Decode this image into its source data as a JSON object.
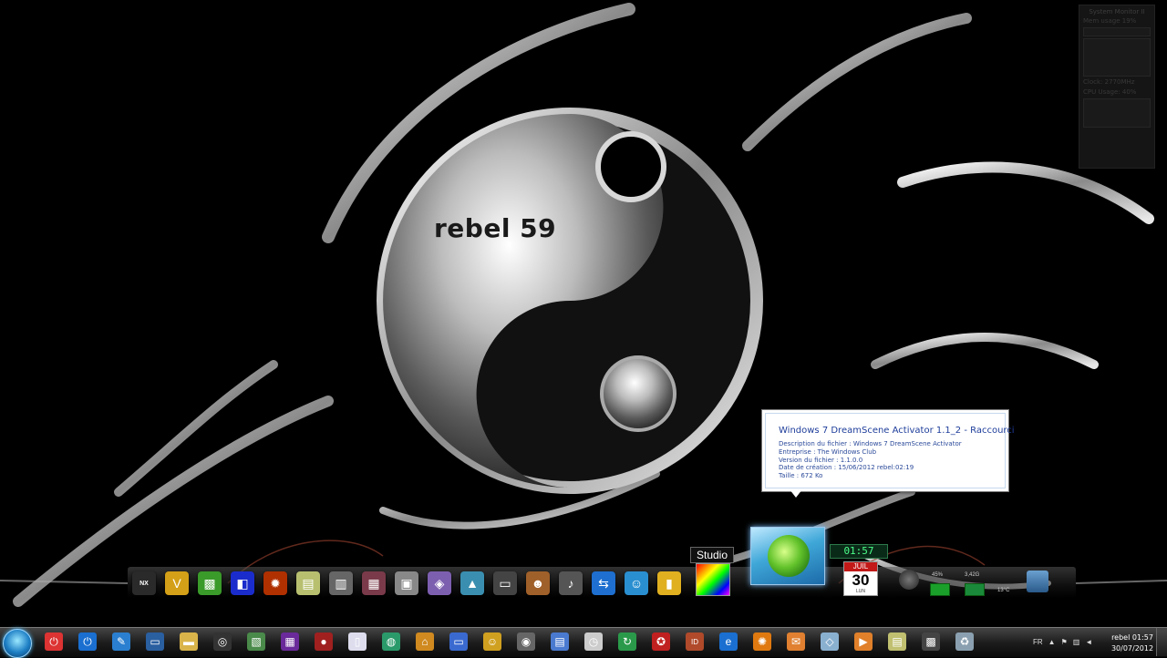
{
  "desktop": {
    "label": "rebel 59"
  },
  "system_monitor": {
    "title": "System Monitor II",
    "memory_label": "Mem usage",
    "memory_value": "19%",
    "clock_label": "Clock:",
    "clock_value": "2770MHz",
    "cpu_label": "CPU Usage:",
    "cpu_value": "40%"
  },
  "tooltip": {
    "title": "Windows 7 DreamScene Activator 1.1_2 - Raccourci",
    "lines": [
      "Description du fichier : Windows 7 DreamScene Activator",
      "Entreprise : The Windows Club",
      "Version du fichier : 1.1.0.0",
      "Date de création : 15/06/2012 rebel:02:19",
      "Taille : 672 Ko"
    ]
  },
  "dock": {
    "icons": [
      {
        "name": "nexus-icon",
        "glyph": "NX",
        "color": "#2a2a2a"
      },
      {
        "name": "v-icon",
        "glyph": "V",
        "color": "#d4a017"
      },
      {
        "name": "green-app-icon",
        "glyph": "▩",
        "color": "#3a9a2a"
      },
      {
        "name": "blue-square-icon",
        "glyph": "◧",
        "color": "#1b2ccc"
      },
      {
        "name": "fire-icon",
        "glyph": "✹",
        "color": "#b03000"
      },
      {
        "name": "notes-icon",
        "glyph": "▤",
        "color": "#b8c070"
      },
      {
        "name": "book-icon",
        "glyph": "▥",
        "color": "#666"
      },
      {
        "name": "book2-icon",
        "glyph": "▦",
        "color": "#7a3a4a"
      },
      {
        "name": "speaker-icon",
        "glyph": "▣",
        "color": "#888"
      },
      {
        "name": "palette-icon",
        "glyph": "◈",
        "color": "#7d5fb0"
      },
      {
        "name": "triangle-icon",
        "glyph": "▲",
        "color": "#3a8fb0"
      },
      {
        "name": "monitor-icon",
        "glyph": "▭",
        "color": "#444"
      },
      {
        "name": "mascot-icon",
        "glyph": "☻",
        "color": "#a0602a"
      },
      {
        "name": "microphone-icon",
        "glyph": "♪",
        "color": "#555"
      },
      {
        "name": "teamviewer-icon",
        "glyph": "⇆",
        "color": "#1e6fd0"
      },
      {
        "name": "user-icon",
        "glyph": "☺",
        "color": "#2a8fd0"
      },
      {
        "name": "folder-yellow-icon",
        "glyph": "▮",
        "color": "#e0b020"
      }
    ],
    "studio_label": "Studio"
  },
  "gadgets": {
    "digital_clock": "01:57",
    "calendar_month": "JUIL",
    "calendar_day": "30",
    "calendar_dow": "LUN",
    "battery_percent": "45%",
    "network_value": "3,42G",
    "temperature": "13°C"
  },
  "taskbar": {
    "icons": [
      {
        "name": "shutdown-icon",
        "glyph": "⏻",
        "color": "#d33"
      },
      {
        "name": "power-icon",
        "glyph": "⏻",
        "color": "#1a6fd0"
      },
      {
        "name": "tools-icon",
        "glyph": "✎",
        "color": "#2a7fd0"
      },
      {
        "name": "computer-icon",
        "glyph": "▭",
        "color": "#2a5fa0"
      },
      {
        "name": "folder-icon",
        "glyph": "▬",
        "color": "#d9b44a"
      },
      {
        "name": "disc-icon",
        "glyph": "◎",
        "color": "#333"
      },
      {
        "name": "image-icon",
        "glyph": "▧",
        "color": "#4a8a4a"
      },
      {
        "name": "cpuz-icon",
        "glyph": "▦",
        "color": "#6a2a9a"
      },
      {
        "name": "ball-icon",
        "glyph": "●",
        "color": "#a02020"
      },
      {
        "name": "document-icon",
        "glyph": "▯",
        "color": "#dde"
      },
      {
        "name": "globe-icon",
        "glyph": "◍",
        "color": "#2a9a6a"
      },
      {
        "name": "home-icon",
        "glyph": "⌂",
        "color": "#d08a20"
      },
      {
        "name": "monitor-small-icon",
        "glyph": "▭",
        "color": "#3a6ad0"
      },
      {
        "name": "smiley-icon",
        "glyph": "☺",
        "color": "#d0a020"
      },
      {
        "name": "camera-icon",
        "glyph": "◉",
        "color": "#666"
      },
      {
        "name": "network-icon",
        "glyph": "▤",
        "color": "#4a7ad0"
      },
      {
        "name": "clock-icon",
        "glyph": "◷",
        "color": "#ccc"
      },
      {
        "name": "refresh-icon",
        "glyph": "↻",
        "color": "#2a9a4a"
      },
      {
        "name": "ccleaner-icon",
        "glyph": "✪",
        "color": "#c02020"
      },
      {
        "name": "id-icon",
        "glyph": "ID",
        "color": "#b04a2a"
      },
      {
        "name": "internet-explorer-icon",
        "glyph": "e",
        "color": "#1a6fd0"
      },
      {
        "name": "firefox-icon",
        "glyph": "✺",
        "color": "#e07a10"
      },
      {
        "name": "mail-icon",
        "glyph": "✉",
        "color": "#e08030"
      },
      {
        "name": "glass-icon",
        "glyph": "◇",
        "color": "#8ab0d0"
      },
      {
        "name": "media-player-icon",
        "glyph": "▶",
        "color": "#e0802a"
      },
      {
        "name": "notepad-icon",
        "glyph": "▤",
        "color": "#c0c070"
      },
      {
        "name": "game-icon",
        "glyph": "▩",
        "color": "#444"
      },
      {
        "name": "recycle-bin-icon",
        "glyph": "♻",
        "color": "#8aa0b0"
      }
    ]
  },
  "tray": {
    "language": "FR",
    "clock_user": "rebel 01:57",
    "date": "30/07/2012"
  }
}
